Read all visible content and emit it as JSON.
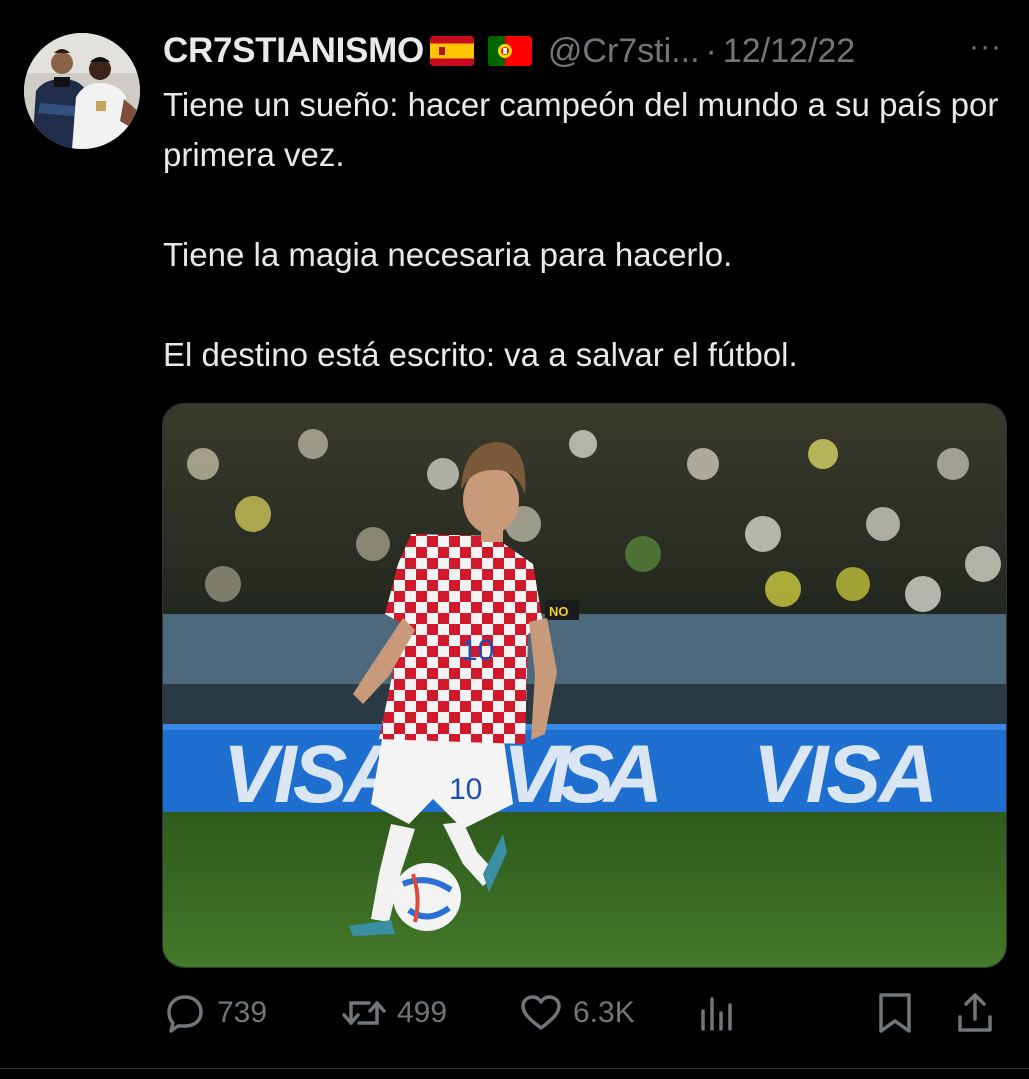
{
  "tweet": {
    "display_name": "CR7STIANISMO",
    "flags": [
      "spain-flag",
      "portugal-flag"
    ],
    "handle": "@Cr7sti...",
    "separator": "·",
    "date": "12/12/22",
    "more": "···",
    "text_lines": [
      "Tiene un sueño: hacer campeón del mundo a su país por primera vez.",
      "Tiene la magia necesaria para hacerlo.",
      "El destino está escrito: va a salvar el fútbol."
    ],
    "media": {
      "board_text": [
        "VISA",
        "VISA",
        "VISA"
      ],
      "shirt_number": "10",
      "armband_text": "NO"
    },
    "actions": {
      "replies": "739",
      "retweets": "499",
      "likes": "6.3K"
    }
  },
  "colors": {
    "background": "#000000",
    "text": "#e7e9ea",
    "secondary": "#71767b",
    "board": "#1f6fd1",
    "pitch": "#3c6b22"
  },
  "icons": [
    "reply-icon",
    "retweet-icon",
    "like-icon",
    "views-icon",
    "bookmark-icon",
    "share-icon"
  ]
}
